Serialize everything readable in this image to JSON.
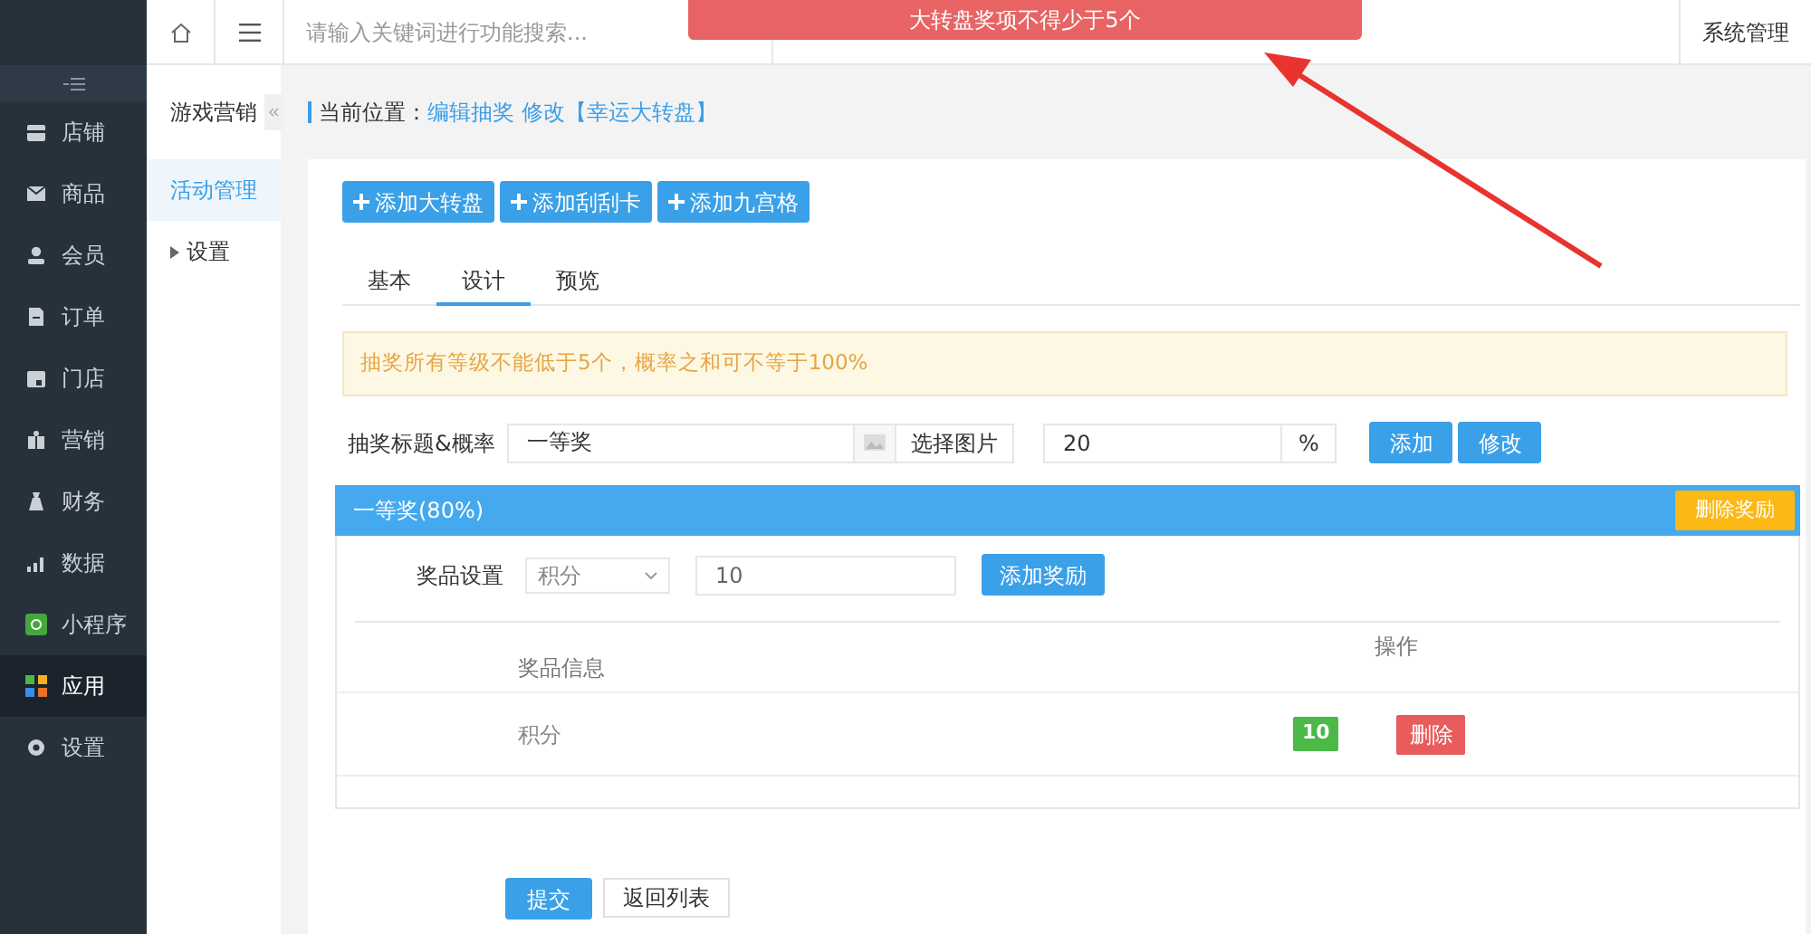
{
  "header": {
    "search": {
      "placeholder": "请输入关键词进行功能搜索..."
    },
    "admin": "系统管理"
  },
  "toast": "大转盘奖项不得少于5个",
  "sidebar": {
    "items": [
      {
        "label": "店铺",
        "selected": false
      },
      {
        "label": "商品",
        "selected": false
      },
      {
        "label": "会员",
        "selected": false
      },
      {
        "label": "订单",
        "selected": false
      },
      {
        "label": "门店",
        "selected": false
      },
      {
        "label": "营销",
        "selected": false
      },
      {
        "label": "财务",
        "selected": false
      },
      {
        "label": "数据",
        "selected": false
      },
      {
        "label": "小程序",
        "selected": false
      },
      {
        "label": "应用",
        "selected": true
      },
      {
        "label": "设置",
        "selected": false
      }
    ]
  },
  "submenu": {
    "title": "游戏营销",
    "items": [
      {
        "label": "活动管理",
        "selected": true,
        "kind": "link"
      },
      {
        "label": "设置",
        "selected": false,
        "kind": "group"
      }
    ]
  },
  "breadcrumb": {
    "label": "当前位置：",
    "path": "编辑抽奖 修改【幸运大转盘】"
  },
  "add_buttons": [
    "添加大转盘",
    "添加刮刮卡",
    "添加九宫格"
  ],
  "tabs": [
    {
      "label": "基本",
      "selected": false
    },
    {
      "label": "设计",
      "selected": true
    },
    {
      "label": "预览",
      "selected": false
    }
  ],
  "notice": "抽奖所有等级不能低于5个，概率之和可不等于100%",
  "form": {
    "label": "抽奖标题&概率",
    "title_value": "一等奖",
    "image_button": "选择图片",
    "rate_value": "20",
    "rate_unit": "%",
    "buttons": [
      "添加",
      "修改"
    ]
  },
  "prize": {
    "title": "一等奖(80%)",
    "delete_button": "删除奖励",
    "setting_label": "奖品设置",
    "type_value": "积分",
    "amount_value": "10",
    "add_button": "添加奖励",
    "columns": [
      "奖品信息",
      "操作"
    ],
    "rows": [
      {
        "info": "积分",
        "amount": "10",
        "action": "删除"
      }
    ]
  },
  "footer_buttons": [
    "提交",
    "返回列表"
  ]
}
